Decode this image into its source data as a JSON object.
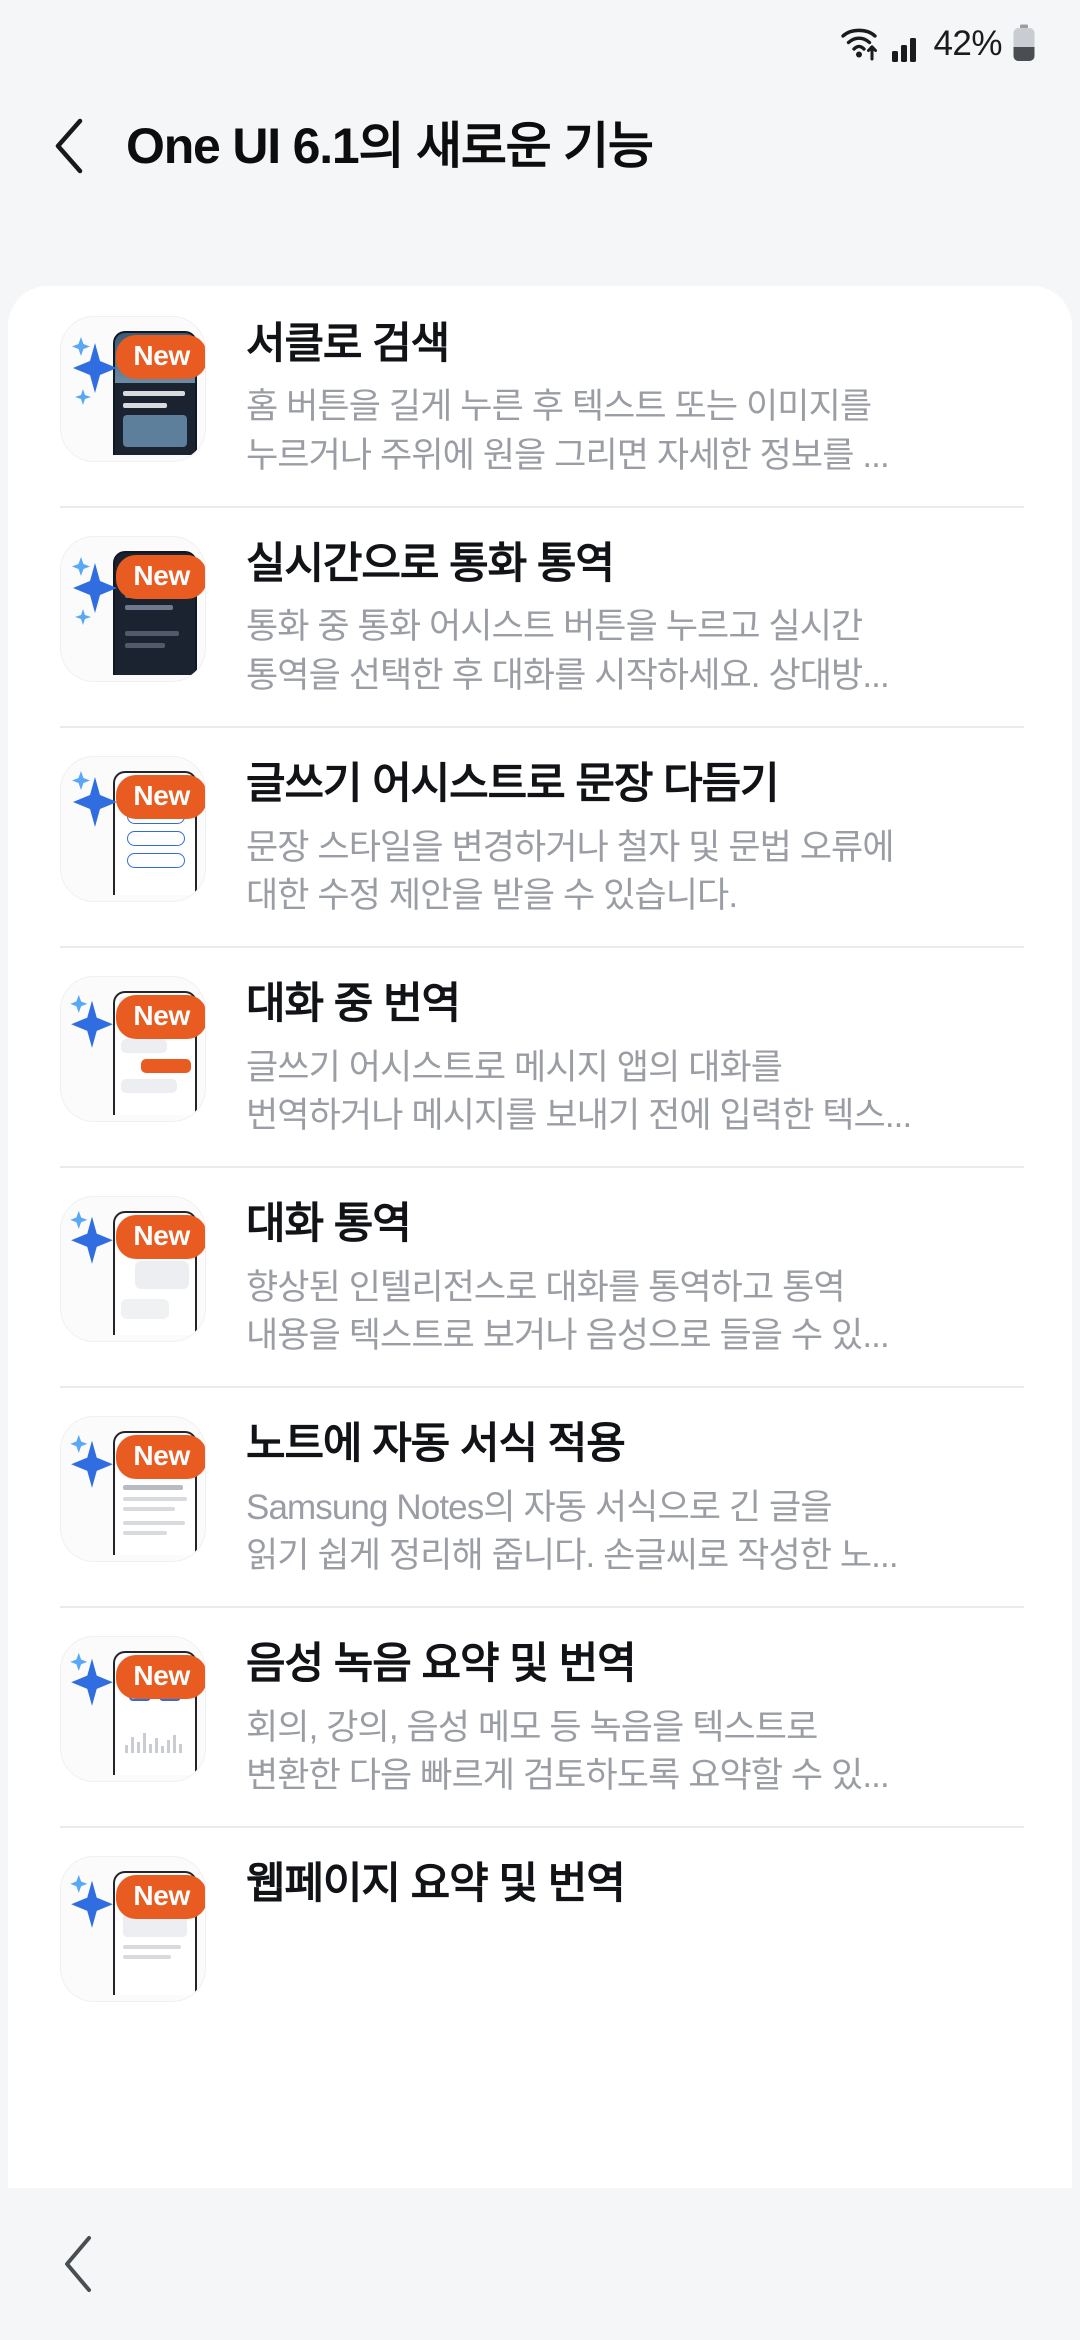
{
  "status_bar": {
    "wifi_icon": "wifi-data-icon",
    "signal_icon": "cellular-signal-icon",
    "battery_percent": "42%",
    "battery_icon": "battery-icon"
  },
  "header": {
    "back_icon": "back-chevron-icon",
    "title": "One UI 6.1의 새로운 기능"
  },
  "badge_label": "New",
  "accent_color": "#e85c22",
  "items": [
    {
      "title": "서클로 검색",
      "desc_lines": [
        "홈 버튼을 길게 누른 후 텍스트 또는 이미지를",
        "누르거나 주위에 원을 그리면 자세한 정보를 ..."
      ],
      "thumb": "circle-to-search-thumbnail",
      "badge": "New"
    },
    {
      "title": "실시간으로 통화 통역",
      "desc_lines": [
        "통화 중 통화 어시스트 버튼을 누르고 실시간",
        "통역을 선택한 후 대화를 시작하세요. 상대방..."
      ],
      "thumb": "live-call-translate-thumbnail",
      "badge": "New"
    },
    {
      "title": "글쓰기 어시스트로 문장 다듬기",
      "desc_lines": [
        "문장 스타일을 변경하거나 철자 및 문법 오류에",
        "대한 수정 제안을 받을 수 있습니다."
      ],
      "thumb": "writing-assist-thumbnail",
      "badge": "New"
    },
    {
      "title": "대화 중 번역",
      "desc_lines": [
        "글쓰기 어시스트로 메시지 앱의 대화를",
        "번역하거나 메시지를 보내기 전에 입력한 텍스..."
      ],
      "thumb": "chat-translation-thumbnail",
      "badge": "New"
    },
    {
      "title": "대화 통역",
      "desc_lines": [
        "향상된 인텔리전스로 대화를 통역하고 통역",
        "내용을 텍스트로 보거나 음성으로 들을 수 있..."
      ],
      "thumb": "interpreter-thumbnail",
      "badge": "New"
    },
    {
      "title": "노트에 자동 서식 적용",
      "desc_lines": [
        "Samsung Notes의 자동 서식으로 긴 글을",
        "읽기 쉽게 정리해 줍니다. 손글씨로 작성한 노..."
      ],
      "thumb": "notes-auto-format-thumbnail",
      "badge": "New"
    },
    {
      "title": "음성 녹음 요약 및 번역",
      "desc_lines": [
        "회의, 강의, 음성 메모 등 녹음을 텍스트로",
        "변환한 다음 빠르게 검토하도록 요약할 수 있..."
      ],
      "thumb": "voice-recorder-summary-thumbnail",
      "badge": "New"
    },
    {
      "title": "웹페이지 요약 및 번역",
      "desc_lines": [],
      "thumb": "webpage-summary-thumbnail",
      "badge": "New"
    }
  ],
  "nav_bar": {
    "back_icon": "nav-back-icon"
  }
}
